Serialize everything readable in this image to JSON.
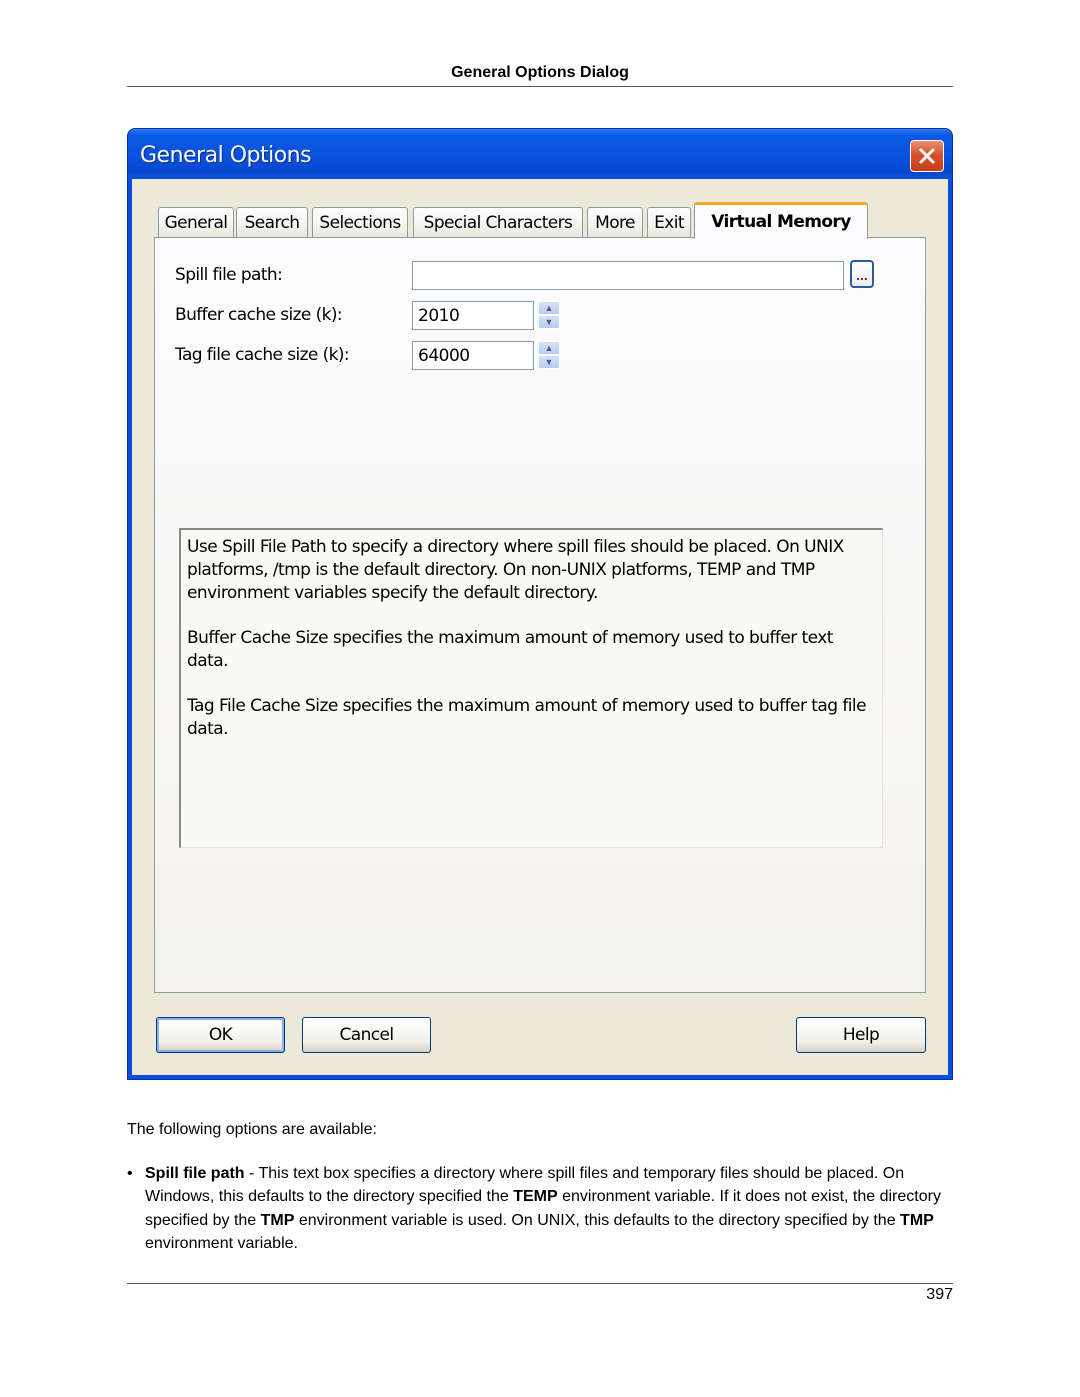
{
  "page": {
    "header_title": "General Options Dialog",
    "page_number": "397"
  },
  "dialog": {
    "title": "General Options",
    "close_icon": "close-x-icon",
    "tabs": [
      {
        "label": "General",
        "active": false
      },
      {
        "label": "Search",
        "active": false
      },
      {
        "label": "Selections",
        "active": false
      },
      {
        "label": "Special Characters",
        "active": false
      },
      {
        "label": "More",
        "active": false
      },
      {
        "label": "Exit",
        "active": false
      },
      {
        "label": "Virtual Memory",
        "active": true
      }
    ],
    "fields": {
      "spill_file_path": {
        "label": "Spill file path:",
        "value": "",
        "browse_label": "..."
      },
      "buffer_cache_size": {
        "label": "Buffer cache size (k):",
        "value": "2010"
      },
      "tag_file_cache_size": {
        "label": "Tag file cache size (k):",
        "value": "64000"
      }
    },
    "description": [
      "Use Spill File Path to specify a directory where spill files should be placed.  On UNIX platforms, /tmp is the default directory.  On non-UNIX platforms, TEMP and TMP environment variables specify the default directory.",
      "Buffer Cache Size specifies the maximum amount of memory used to buffer text data.",
      "Tag File Cache Size specifies the maximum amount of memory used to buffer tag file data."
    ],
    "buttons": {
      "ok": "OK",
      "cancel": "Cancel",
      "help": "Help"
    },
    "colors": {
      "titlebar": "#0a52de",
      "client_bg": "#ece9d8",
      "active_tab_accent": "#f5a623",
      "close_button": "#d8532a"
    }
  },
  "body": {
    "intro": "The following options are available:",
    "bullets": [
      {
        "segments": [
          {
            "text": "Spill file path",
            "bold": true
          },
          {
            "text": " - This text box specifies a directory where spill files and temporary files should be placed. On Windows, this defaults to the directory specified the ",
            "bold": false
          },
          {
            "text": "TEMP",
            "bold": true
          },
          {
            "text": " environment variable. If it does not exist, the directory specified by the ",
            "bold": false
          },
          {
            "text": "TMP",
            "bold": true
          },
          {
            "text": " environment variable is used. On UNIX, this defaults to the directory specified by the ",
            "bold": false
          },
          {
            "text": "TMP",
            "bold": true
          },
          {
            "text": " environment variable.",
            "bold": false
          }
        ]
      }
    ]
  }
}
